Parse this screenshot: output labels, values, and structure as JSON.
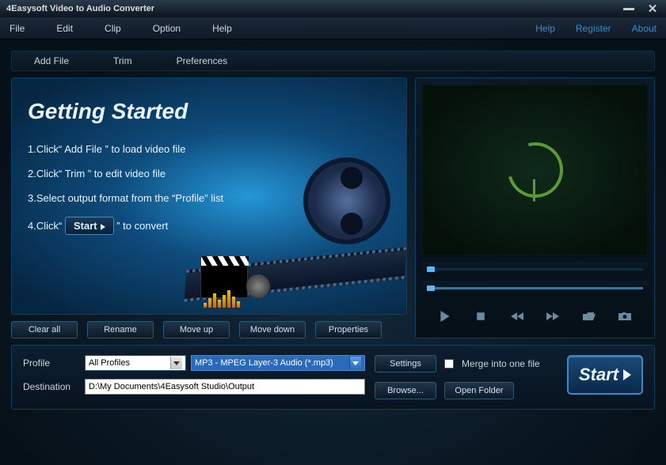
{
  "title": "4Easysoft Video to Audio Converter",
  "menu": {
    "file": "File",
    "edit": "Edit",
    "clip": "Clip",
    "option": "Option",
    "help": "Help"
  },
  "links": {
    "help": "Help",
    "register": "Register",
    "about": "About"
  },
  "toolbar": {
    "add": "Add File",
    "trim": "Trim",
    "prefs": "Preferences"
  },
  "welcome": {
    "heading": "Getting Started",
    "step1": "1.Click“ Add File ” to load video file",
    "step2": "2.Click“ Trim ” to edit video file",
    "step3": "3.Select output format from the “Profile” list",
    "step4a": "4.Click“",
    "step4btn": "Start",
    "step4b": "” to convert"
  },
  "actions": {
    "clear": "Clear all",
    "rename": "Rename",
    "up": "Move up",
    "down": "Move down",
    "props": "Properties"
  },
  "bottom": {
    "profile_label": "Profile",
    "profile_group": "All Profiles",
    "profile_format": "MP3 - MPEG Layer-3 Audio (*.mp3)",
    "settings": "Settings",
    "merge": "Merge into one file",
    "dest_label": "Destination",
    "dest_path": "D:\\My Documents\\4Easysoft Studio\\Output",
    "browse": "Browse...",
    "open": "Open Folder",
    "start": "Start"
  }
}
